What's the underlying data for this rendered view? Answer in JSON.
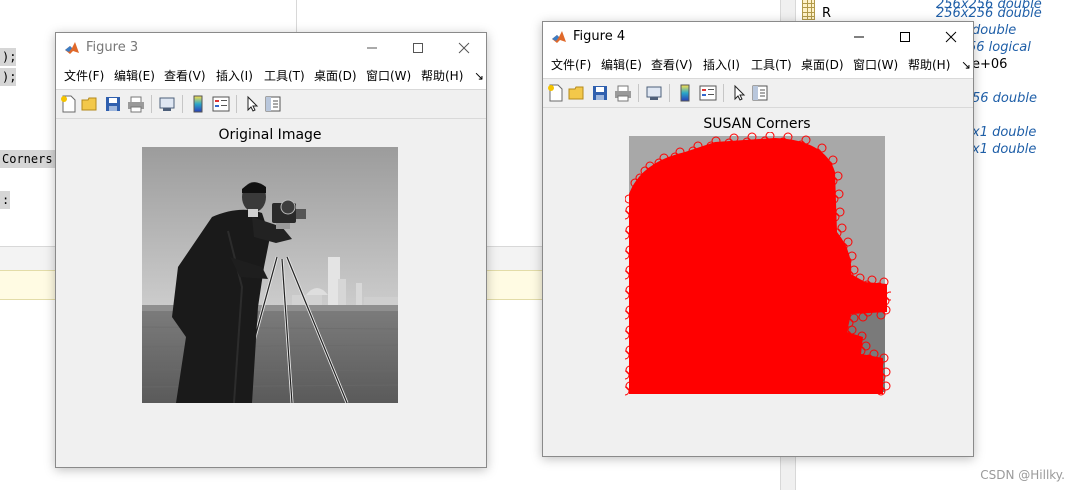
{
  "background": {
    "code_fragments": [
      ");",
      ");",
      "Corners'",
      ":"
    ],
    "workspace": [
      {
        "name": "R",
        "value": "256x256 double"
      },
      {
        "name": "",
        "value": "double"
      },
      {
        "name": "",
        "value": "56 logical"
      },
      {
        "name": "",
        "value": "e+06"
      },
      {
        "name": "",
        "value": "56 double"
      },
      {
        "name": "",
        "value": "x1 double"
      },
      {
        "name": "",
        "value": "x1 double"
      }
    ],
    "watermark": "CSDN @Hillky."
  },
  "figure3": {
    "title": "Figure 3",
    "menu": [
      "文件(F)",
      "编辑(E)",
      "查看(V)",
      "插入(I)",
      "工具(T)",
      "桌面(D)",
      "窗口(W)",
      "帮助(H)"
    ],
    "overflow_glyph": "↘",
    "axes_title": "Original Image",
    "image": "cameraman grayscale photo"
  },
  "figure4": {
    "title": "Figure 4",
    "menu": [
      "文件(F)",
      "编辑(E)",
      "查看(V)",
      "插入(I)",
      "工具(T)",
      "桌面(D)",
      "窗口(W)",
      "帮助(H)"
    ],
    "overflow_glyph": "↘",
    "axes_title": "SUSAN Corners",
    "marker_color": "#ff0000",
    "marker_shape": "circle (o)"
  },
  "colors": {
    "window_bg": "#f0f0f0",
    "titlebar_bg": "#ffffff",
    "accent_red": "#ff0000",
    "workspace_value_blue": "#1f5fa8"
  }
}
